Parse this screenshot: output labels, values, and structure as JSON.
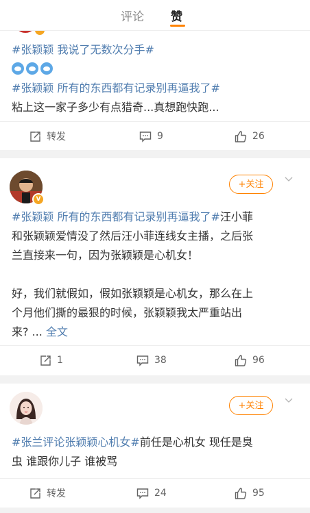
{
  "tabs": {
    "comment": "评论",
    "like": "赞"
  },
  "colors": {
    "accent": "#ff8200",
    "link": "#507daf",
    "text": "#333333",
    "muted": "#636363"
  },
  "post1": {
    "tag1": "#张颖颖 我说了无数次分手#",
    "emojis": [
      "doraemon-emoji",
      "doraemon-emoji",
      "doraemon-emoji"
    ],
    "tag2": "#张颖颖 所有的东西都有记录别再逼我了#",
    "text": "粘上这一家子多少有点猎奇...真想跑快跑...",
    "repost": "转发",
    "comments": "9",
    "likes": "26"
  },
  "post2": {
    "follow": "+关注",
    "tag": "#张颖颖 所有的东西都有记录别再逼我了#",
    "text_a": "汪小菲",
    "text_b": "和张颖颖爱情没了然后汪小菲连线女主播，之后张",
    "text_c": "兰直接来一句，因为张颖颖是心机女！",
    "text_d": "好，我们就假如，假如张颖颖是心机女，那么在上",
    "text_e": "个月他们撕的最狠的时候，张颖颖我太严重站出",
    "text_f": "来? ...",
    "more": "全文",
    "repost": "1",
    "comments": "38",
    "likes": "96"
  },
  "post3": {
    "follow": "+关注",
    "tag": "#张兰评论张颖颖心机女#",
    "text_a": "前任是心机女 现任是臭",
    "text_b": "虫 谁跟你儿子 谁被骂",
    "repost": "转发",
    "comments": "24",
    "likes": "95"
  }
}
